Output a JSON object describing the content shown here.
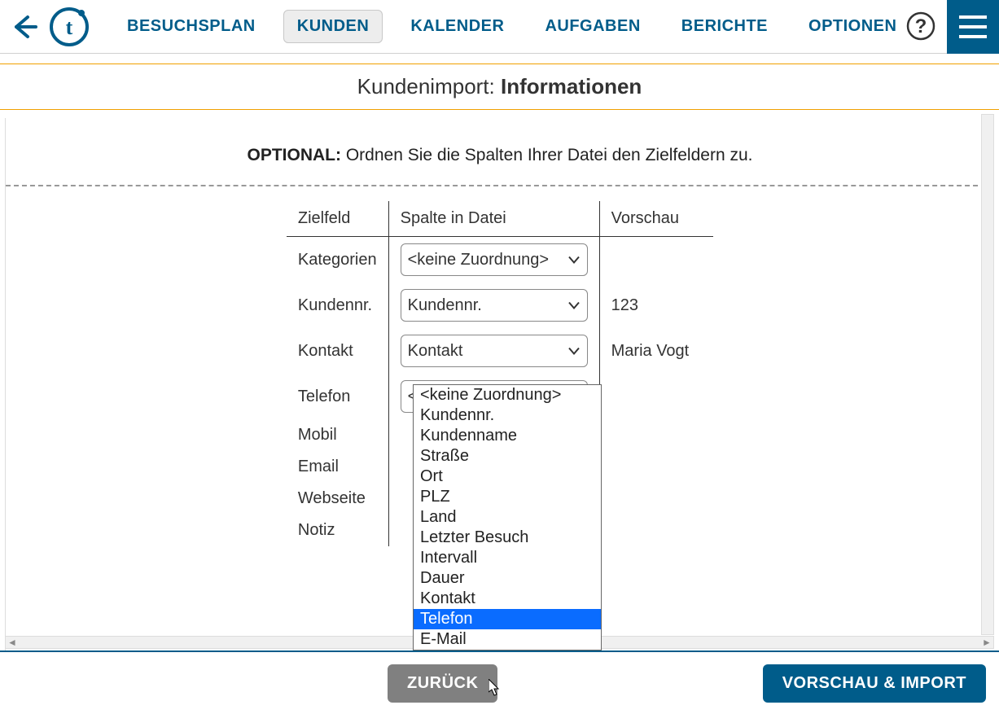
{
  "nav": {
    "items": [
      "BESUCHSPLAN",
      "KUNDEN",
      "KALENDER",
      "AUFGABEN",
      "BERICHTE",
      "OPTIONEN"
    ],
    "active_index": 1
  },
  "subheader": {
    "prefix": "Kundenimport: ",
    "bold": "Informationen"
  },
  "optional": {
    "label": "OPTIONAL:",
    "text": " Ordnen Sie die Spalten Ihrer Datei den Zielfeldern zu."
  },
  "table": {
    "headers": [
      "Zielfeld",
      "Spalte in Datei",
      "Vorschau"
    ],
    "rows": [
      {
        "field": "Kategorien",
        "selected": "<keine Zuordnung>",
        "preview": ""
      },
      {
        "field": "Kundennr.",
        "selected": "Kundennr.",
        "preview": "123"
      },
      {
        "field": "Kontakt",
        "selected": "Kontakt",
        "preview": "Maria Vogt"
      },
      {
        "field": "Telefon",
        "selected": "<keine Zuordnung>",
        "preview": ""
      },
      {
        "field": "Mobil",
        "selected": "",
        "preview": ""
      },
      {
        "field": "Email",
        "selected": "",
        "preview": ""
      },
      {
        "field": "Webseite",
        "selected": "",
        "preview": ""
      },
      {
        "field": "Notiz",
        "selected": "",
        "preview": ""
      }
    ]
  },
  "dropdown": {
    "options": [
      "<keine Zuordnung>",
      "Kundennr.",
      "Kundenname",
      "Straße",
      "Ort",
      "PLZ",
      "Land",
      "Letzter Besuch",
      "Intervall",
      "Dauer",
      "Kontakt",
      "Telefon",
      "E-Mail"
    ],
    "highlighted_index": 11
  },
  "footer": {
    "back": "ZURÜCK",
    "primary": "VORSCHAU & IMPORT"
  }
}
